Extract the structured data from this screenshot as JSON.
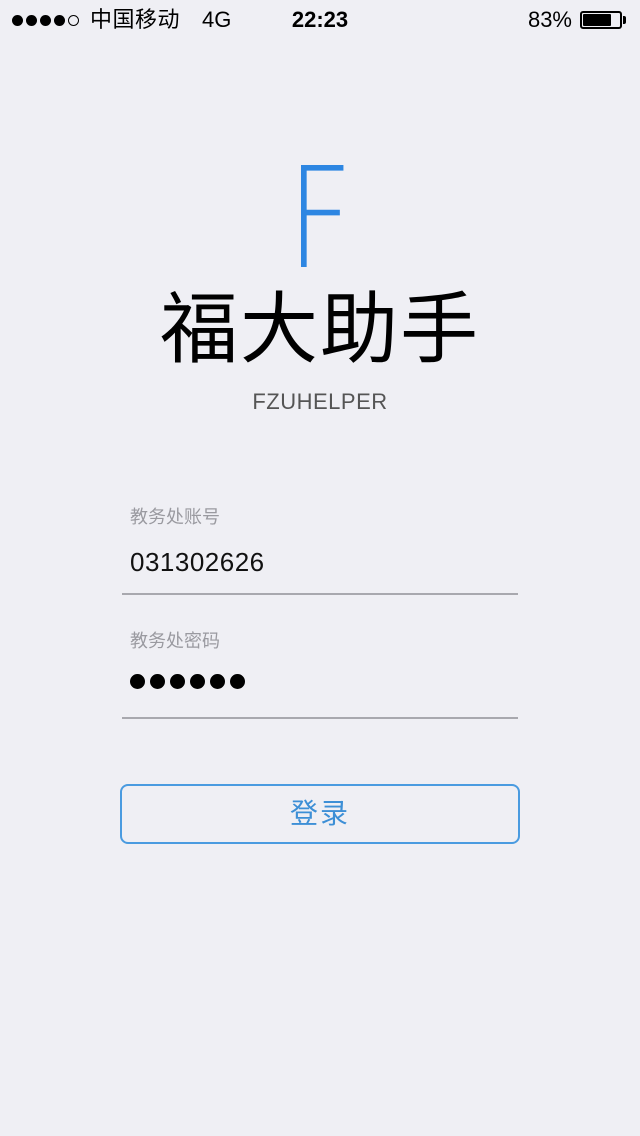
{
  "status_bar": {
    "signal_bars_filled": 4,
    "signal_bars_total": 5,
    "carrier": "中国移动",
    "network": "4G",
    "time": "22:23",
    "battery_percent_label": "83%",
    "battery_level": 0.83
  },
  "logo": {
    "letter": "F",
    "accent_color": "#2d86e2"
  },
  "app": {
    "title": "福大助手",
    "subtitle": "FZUHELPER"
  },
  "form": {
    "account": {
      "label": "教务处账号",
      "value": "031302626"
    },
    "password": {
      "label": "教务处密码",
      "masked_length": 6
    },
    "login_label": "登录"
  }
}
